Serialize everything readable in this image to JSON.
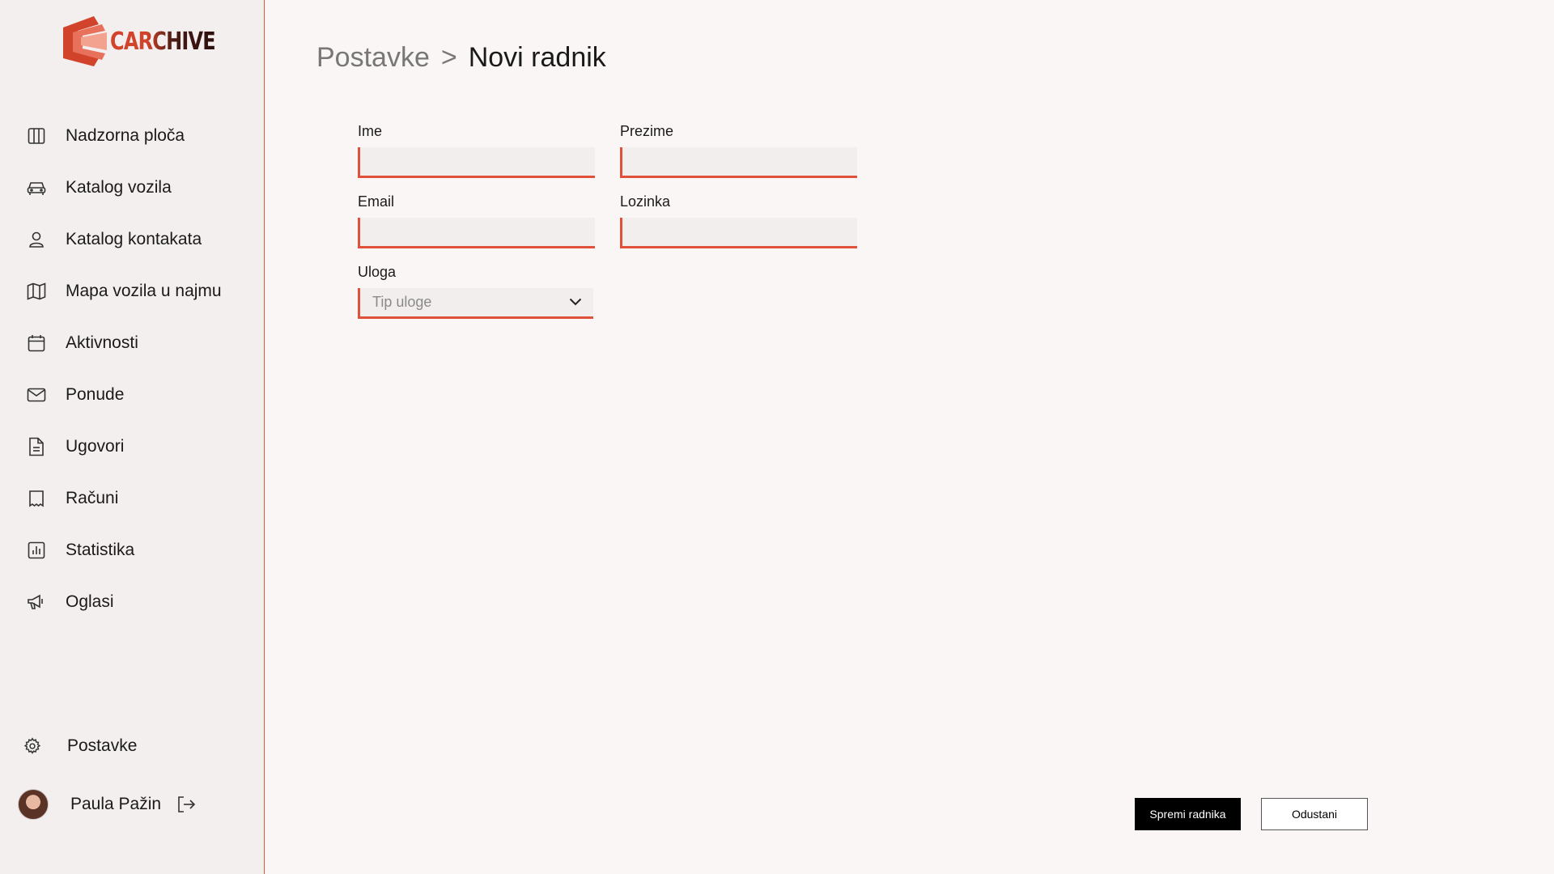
{
  "brand": {
    "name": "CARCHIVE",
    "accent": "#e0513b"
  },
  "sidebar": {
    "items": [
      {
        "label": "Nadzorna ploča",
        "icon": "dashboard-columns-icon"
      },
      {
        "label": "Katalog vozila",
        "icon": "car-icon"
      },
      {
        "label": "Katalog kontakata",
        "icon": "user-icon"
      },
      {
        "label": "Mapa vozila u najmu",
        "icon": "map-icon"
      },
      {
        "label": "Aktivnosti",
        "icon": "calendar-icon"
      },
      {
        "label": "Ponude",
        "icon": "mail-icon"
      },
      {
        "label": "Ugovori",
        "icon": "document-icon"
      },
      {
        "label": "Računi",
        "icon": "receipt-icon"
      },
      {
        "label": "Statistika",
        "icon": "bar-chart-icon"
      },
      {
        "label": "Oglasi",
        "icon": "megaphone-icon"
      }
    ],
    "settings": {
      "label": "Postavke",
      "icon": "gear-icon"
    },
    "user": {
      "name": "Paula Pažin",
      "logout_icon": "logout-icon"
    }
  },
  "breadcrumb": {
    "parent": "Postavke",
    "separator": ">",
    "current": "Novi radnik"
  },
  "form": {
    "first_name": {
      "label": "Ime",
      "value": ""
    },
    "last_name": {
      "label": "Prezime",
      "value": ""
    },
    "email": {
      "label": "Email",
      "value": ""
    },
    "password": {
      "label": "Lozinka",
      "value": ""
    },
    "role": {
      "label": "Uloga",
      "placeholder": "Tip uloge"
    }
  },
  "actions": {
    "save": "Spremi radnika",
    "cancel": "Odustani"
  }
}
